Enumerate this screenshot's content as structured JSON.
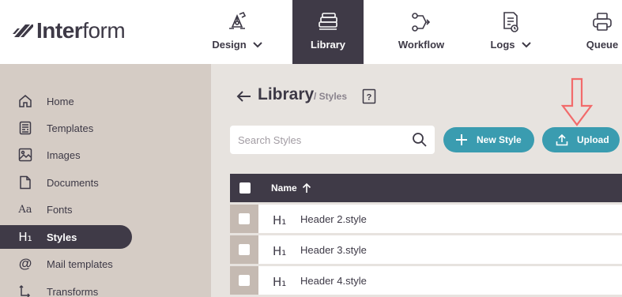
{
  "brand": {
    "bold": "Inter",
    "light": "form"
  },
  "topnav": [
    {
      "label": "Design",
      "icon": "pen-nib-icon",
      "dropdown": true,
      "active": false
    },
    {
      "label": "Library",
      "icon": "library-stack-icon",
      "dropdown": false,
      "active": true
    },
    {
      "label": "Workflow",
      "icon": "workflow-icon",
      "dropdown": false,
      "active": false
    },
    {
      "label": "Logs",
      "icon": "log-document-icon",
      "dropdown": true,
      "active": false
    },
    {
      "label": "Queue",
      "icon": "printer-icon",
      "dropdown": false,
      "active": false
    }
  ],
  "sidebar": {
    "items": [
      {
        "label": "Home",
        "icon": "home-icon"
      },
      {
        "label": "Templates",
        "icon": "template-icon"
      },
      {
        "label": "Images",
        "icon": "image-icon"
      },
      {
        "label": "Documents",
        "icon": "document-icon"
      },
      {
        "label": "Fonts",
        "icon": "font-icon"
      },
      {
        "label": "Styles",
        "icon": "heading-icon",
        "active": true
      },
      {
        "label": "Mail templates",
        "icon": "at-sign-icon"
      },
      {
        "label": "Transforms",
        "icon": "transform-icon"
      }
    ]
  },
  "page": {
    "title": "Library",
    "breadcrumb": "/ Styles",
    "help_icon": "help-icon"
  },
  "search": {
    "placeholder": "Search Styles",
    "value": ""
  },
  "buttons": {
    "new_style": "New Style",
    "upload": "Upload"
  },
  "colors": {
    "accent": "#3a9cb0",
    "dark": "#3f3a47",
    "sidebar": "#d5ccc5",
    "annotation": "#f26b6b"
  },
  "table": {
    "columns": [
      {
        "label": "Name",
        "sort": "ascending"
      }
    ],
    "rows": [
      {
        "icon": "H₁",
        "name": "Header 2.style"
      },
      {
        "icon": "H₁",
        "name": "Header 3.style"
      },
      {
        "icon": "H₁",
        "name": "Header 4.style"
      }
    ]
  }
}
